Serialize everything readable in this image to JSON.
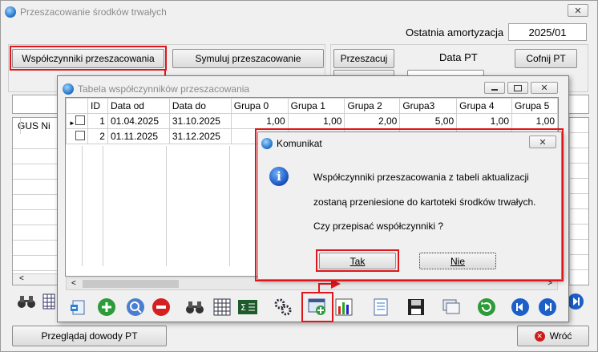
{
  "main": {
    "title": "Przeszacowanie środków trwałych",
    "last_amort_label": "Ostatnia amortyzacja",
    "last_amort_value": "2025/01",
    "tab_wspolczynniki": "Współczynniki  przeszacowania",
    "tab_symuluj": "Symuluj przeszacowanie",
    "btn_przeszacuj": "Przeszacuj",
    "data_pt_label": "Data PT",
    "btn_cofnij": "Cofnij  PT",
    "gus_col": "GUS Ni",
    "btn_przegladaj": "Przeglądaj dowody PT",
    "btn_wroc": "Wróć",
    "close_glyph": "✕"
  },
  "table_window": {
    "title": "Tabela współczynników przeszacowania",
    "columns": [
      "ID",
      "Data od",
      "Data do",
      "Grupa 0",
      "Grupa 1",
      "Grupa 2",
      "Grupa3",
      "Grupa 4",
      "Grupa 5"
    ],
    "rows": [
      {
        "id": "1",
        "od": "01.04.2025",
        "do": "31.10.2025",
        "g0": "1,00",
        "g1": "1,00",
        "g2": "2,00",
        "g3": "5,00",
        "g4": "1,00",
        "g5": "1,00"
      },
      {
        "id": "2",
        "od": "01.11.2025",
        "do": "31.12.2025"
      }
    ]
  },
  "dialog": {
    "title": "Komunikat",
    "line1": "Współczynniki przeszacowania z tabeli aktualizacji",
    "line2": "zostaną przeniesione do kartoteki środków trwałych.",
    "line3": "Czy przepisać współczynniki ?",
    "btn_yes": "Tak",
    "btn_no": "Nie",
    "close_glyph": "✕"
  },
  "colors": {
    "highlight": "#e0161b",
    "accent": "#1a6fc4"
  }
}
